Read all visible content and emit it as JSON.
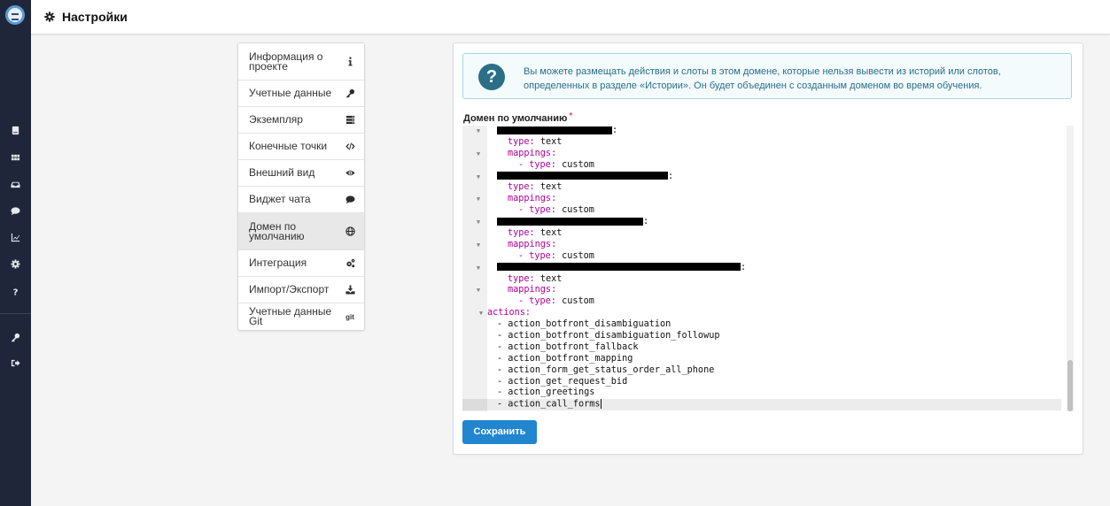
{
  "header": {
    "title": "Настройки",
    "icon": "gear-icon"
  },
  "app_sidebar": {
    "icons": [
      "app-logo",
      "book-icon",
      "grid-icon",
      "inbox-icon",
      "chat-icon",
      "chart-icon",
      "gear-icon",
      "question-icon",
      "key-icon",
      "logout-icon"
    ]
  },
  "menu": {
    "items": [
      {
        "label": "Информация о проекте",
        "icon": "info-icon"
      },
      {
        "label": "Учетные данные",
        "icon": "key-icon"
      },
      {
        "label": "Экземпляр",
        "icon": "server-icon"
      },
      {
        "label": "Конечные точки",
        "icon": "code-icon"
      },
      {
        "label": "Внешний вид",
        "icon": "eye-icon"
      },
      {
        "label": "Виджет чата",
        "icon": "comment-icon"
      },
      {
        "label": "Домен по умолчанию",
        "icon": "globe-icon",
        "active": true
      },
      {
        "label": "Интеграция",
        "icon": "cogs-icon"
      },
      {
        "label": "Импорт/Экспорт",
        "icon": "download-icon"
      },
      {
        "label": "Учетные данные Git",
        "icon": "git-icon",
        "icon_text": "git"
      }
    ]
  },
  "info": {
    "text": "Вы можете размещать действия и слоты в этом домене, которые нельзя вывести из историй или слотов, определенных в разделе «Истории». Он будет объединен с созданным доменом во время обучения."
  },
  "field": {
    "label": "Домен по умолчанию",
    "required_mark": "*"
  },
  "editor": {
    "lines": {
      "l1_colon": ":",
      "l2_type_key": "type:",
      "l2_type_val": "text",
      "l3_key": "mappings:",
      "l4_key": "- type:",
      "l4_val": "custom",
      "l5_colon": ":",
      "l6_type_key": "type:",
      "l6_type_val": "text",
      "l7_key": "mappings:",
      "l8_key": "- type:",
      "l8_val": "custom",
      "l9_colon": ":",
      "l10_type_key": "type:",
      "l10_type_val": "text",
      "l11_key": "mappings:",
      "l12_key": "- type:",
      "l12_val": "custom",
      "l13_colon": ":",
      "l14_type_key": "type:",
      "l14_type_val": "text",
      "l15_key": "mappings:",
      "l16_key": "- type:",
      "l16_val": "custom",
      "l17_key": "actions:"
    },
    "actions": [
      "- action_botfront_disambiguation",
      "- action_botfront_disambiguation_followup",
      "- action_botfront_fallback",
      "- action_botfront_mapping",
      "- action_form_get_status_order_all_phone",
      "- action_get_request_bid",
      "- action_greetings",
      "- action_call_forms"
    ]
  },
  "save_button": {
    "label": "Сохранить"
  }
}
